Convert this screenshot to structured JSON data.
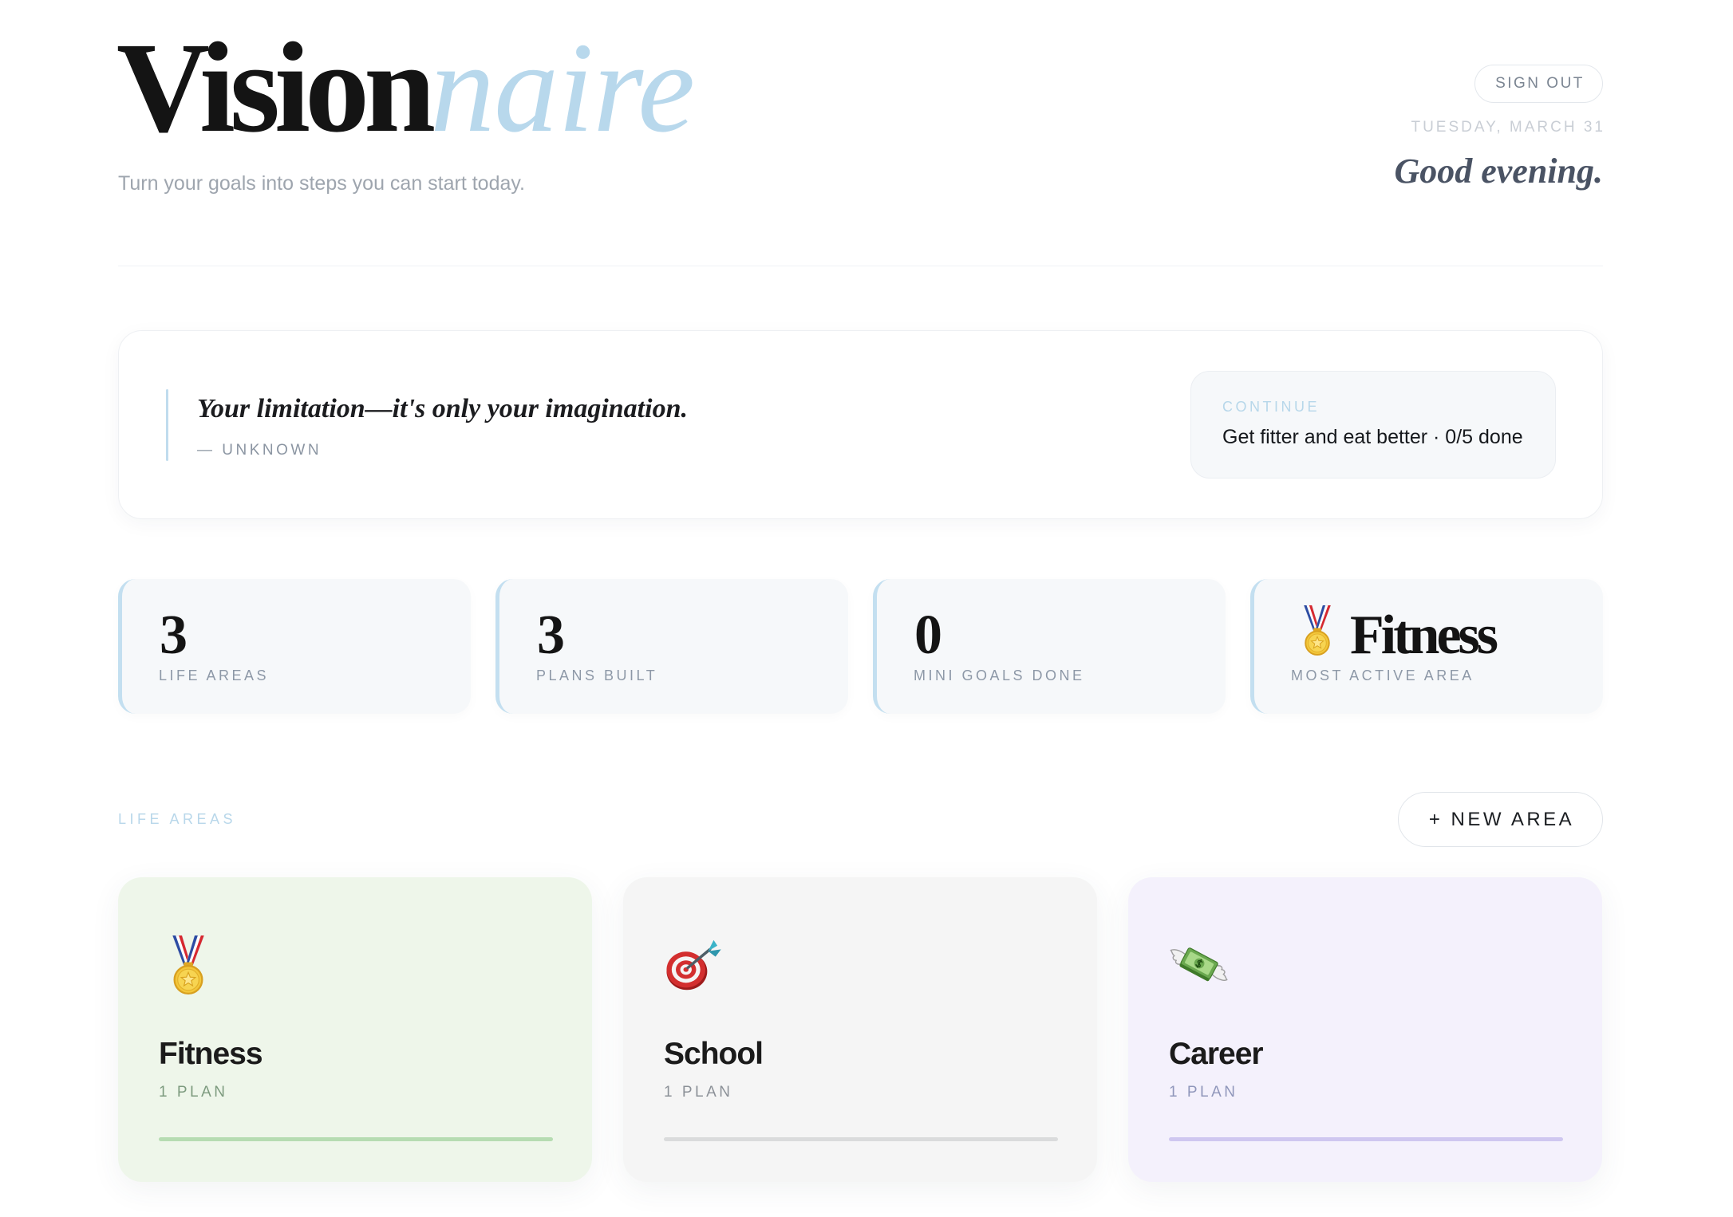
{
  "brand": {
    "name_main": "Vision",
    "name_accent": "naire",
    "tagline": "Turn your goals into steps you can start today."
  },
  "header": {
    "sign_out": "SIGN OUT",
    "date": "TUESDAY, MARCH 31",
    "greeting": "Good evening."
  },
  "quote": {
    "text": "Your limitation—it's only your imagination.",
    "author": "— UNKNOWN"
  },
  "continue": {
    "label": "CONTINUE",
    "text": "Get fitter and eat better · 0/5 done"
  },
  "stats": [
    {
      "value": "3",
      "label": "LIFE AREAS"
    },
    {
      "value": "3",
      "label": "PLANS BUILT"
    },
    {
      "value": "0",
      "label": "MINI GOALS DONE"
    },
    {
      "value": "Fitness",
      "icon": "medal-icon",
      "label": "MOST ACTIVE AREA"
    }
  ],
  "life_areas": {
    "section_label": "LIFE AREAS",
    "new_area": "+ NEW AREA",
    "items": [
      {
        "name": "Fitness",
        "icon": "medal-icon",
        "plans": "1 PLAN",
        "bg": "#eef6ea",
        "accent": "#b6dcb2",
        "plans_color": "#7d9b7f"
      },
      {
        "name": "School",
        "icon": "target-icon",
        "plans": "1 PLAN",
        "bg": "#f5f5f5",
        "accent": "#dadbdc",
        "plans_color": "#8c9198"
      },
      {
        "name": "Career",
        "icon": "money-with-wings-icon",
        "plans": "1 PLAN",
        "bg": "#f4f1fc",
        "accent": "#cfc7f0",
        "plans_color": "#9097bb"
      }
    ]
  },
  "colors": {
    "ink": "#141414",
    "accent_blue": "#b8d8ec",
    "muted": "#8d98a7",
    "surface": "#f6f8fa"
  }
}
